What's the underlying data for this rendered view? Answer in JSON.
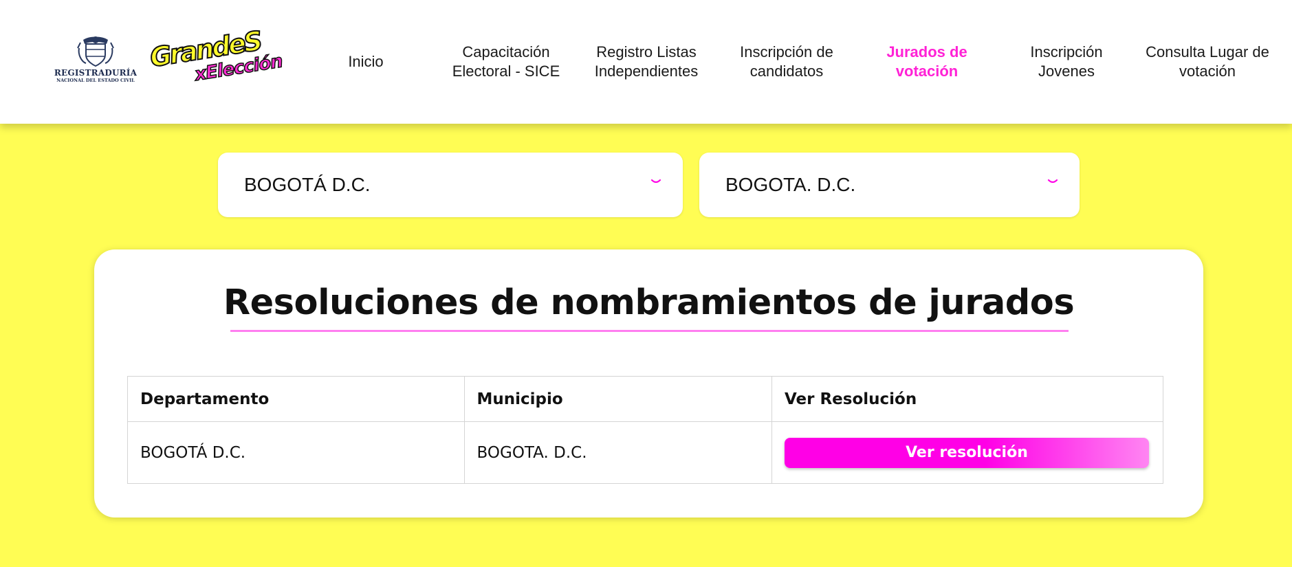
{
  "header": {
    "logo_registraduria": {
      "name": "REGISTRADURÍA",
      "subtitle": "NACIONAL DEL ESTADO CIVIL"
    },
    "logo_campaign": {
      "line1": "GrandeS",
      "line2": "xElección"
    },
    "nav": [
      {
        "label": "Inicio",
        "active": false
      },
      {
        "label": "Capacitación Electoral - SICE",
        "active": false
      },
      {
        "label": "Registro Listas Independientes",
        "active": false
      },
      {
        "label": "Inscripción de candidatos",
        "active": false
      },
      {
        "label": "Jurados de votación",
        "active": true
      },
      {
        "label": "Inscripción Jovenes",
        "active": false
      },
      {
        "label": "Consulta Lugar de votación",
        "active": false
      }
    ]
  },
  "filters": {
    "departamento": {
      "value": "BOGOTÁ D.C.",
      "icon": "chevron-down-icon"
    },
    "municipio": {
      "value": "BOGOTA. D.C.",
      "icon": "chevron-down-icon"
    }
  },
  "card": {
    "title": "Resoluciones de nombramientos de jurados",
    "table": {
      "headers": [
        "Departamento",
        "Municipio",
        "Ver Resolución"
      ],
      "rows": [
        {
          "departamento": "BOGOTÁ D.C.",
          "municipio": "BOGOTA. D.C.",
          "button_label": "Ver resolución"
        }
      ]
    }
  },
  "colors": {
    "background": "#FFFD54",
    "accent": "#FF22D6",
    "button_gradient_start": "#FF00E6",
    "button_gradient_end": "#FF85F2"
  }
}
